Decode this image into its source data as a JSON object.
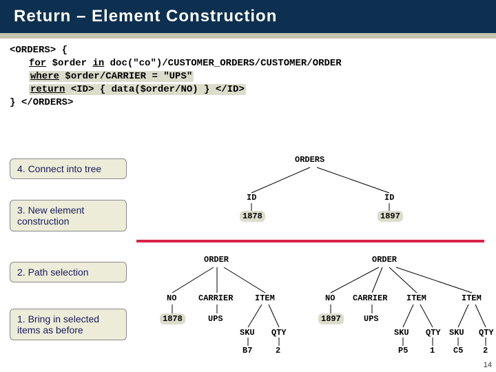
{
  "title": "Return – Element Construction",
  "code": {
    "l1a": "<ORDERS>",
    "l1b": " {",
    "l2a": "for",
    "l2b": " $order ",
    "l2c": "in",
    "l2d": " doc(\"co\")/CUSTOMER_ORDERS/CUSTOMER/ORDER",
    "l3a": "where",
    "l3b": " $order/CARRIER = \"UPS\"",
    "l4a": "return",
    "l4b": " <ID> { data($order/NO) } </ID>",
    "l5a": "} ",
    "l5b": "</ORDERS>"
  },
  "steps": {
    "s4": "4. Connect into tree",
    "s3": "3. New element construction",
    "s2": "2. Path selection",
    "s1": "1. Bring in selected items as before"
  },
  "topTree": {
    "root": "ORDERS",
    "left": {
      "label": "ID",
      "val": "1878"
    },
    "right": {
      "label": "ID",
      "val": "1897"
    }
  },
  "bottom": {
    "left": {
      "root": "ORDER",
      "no": {
        "label": "NO",
        "val": "1878"
      },
      "carrier": {
        "label": "CARRIER",
        "val": "UPS"
      },
      "item": {
        "label": "ITEM",
        "sku": {
          "label": "SKU",
          "val": "B7"
        },
        "qty": {
          "label": "QTY",
          "val": "2"
        }
      }
    },
    "right": {
      "root": "ORDER",
      "no": {
        "label": "NO",
        "val": "1897"
      },
      "carrier": {
        "label": "CARRIER",
        "val": "UPS"
      },
      "item1": {
        "label": "ITEM",
        "sku": {
          "label": "SKU",
          "val": "P5"
        },
        "qty": {
          "label": "QTY",
          "val": "1"
        }
      },
      "item2": {
        "label": "ITEM",
        "sku": {
          "label": "SKU",
          "val": "C5"
        },
        "qty": {
          "label": "QTY",
          "val": "2"
        }
      }
    }
  },
  "pageNumber": "14"
}
